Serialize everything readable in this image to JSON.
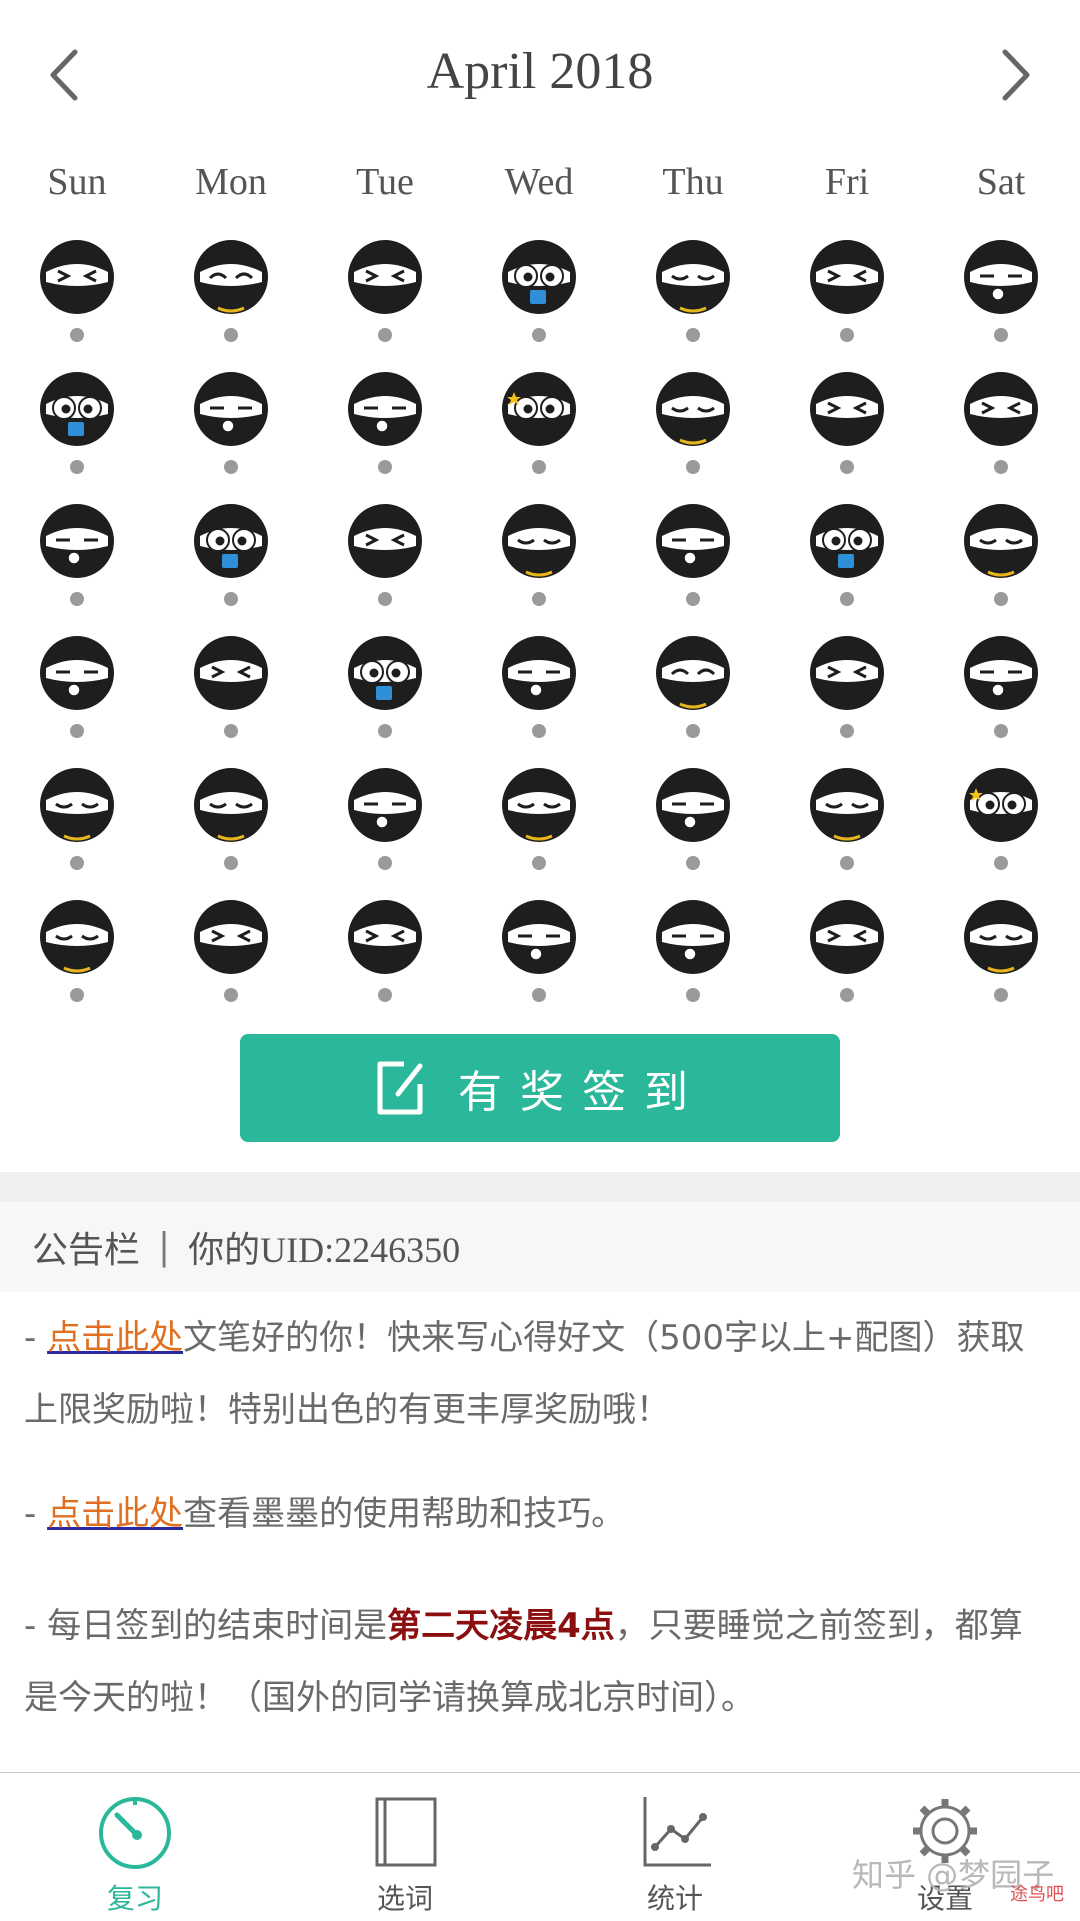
{
  "header": {
    "title": "April 2018",
    "prev_icon": "chevron-left-icon",
    "next_icon": "chevron-right-icon"
  },
  "weekdays": [
    "Sun",
    "Mon",
    "Tue",
    "Wed",
    "Thu",
    "Fri",
    "Sat"
  ],
  "calendar": {
    "rows": [
      [
        "squint",
        "wink",
        "squint",
        "book",
        "sleepy",
        "squint",
        "monocle"
      ],
      [
        "book",
        "monocle",
        "monocle",
        "star",
        "sleepy",
        "squint",
        "squint"
      ],
      [
        "monocle",
        "book",
        "squint",
        "sleepy",
        "monocle",
        "book",
        "sleepy"
      ],
      [
        "monocle",
        "squint",
        "book",
        "monocle",
        "wink",
        "squint",
        "monocle"
      ],
      [
        "sleepy",
        "sleepy",
        "monocle",
        "sleepy",
        "monocle",
        "sleepy",
        "star"
      ],
      [
        "sleepy",
        "squint",
        "squint",
        "monocle",
        "monocle",
        "squint",
        "sleepy"
      ]
    ],
    "dot_color": "#9a9a9a"
  },
  "checkin": {
    "label": "有奖签到",
    "icon": "edit-icon",
    "color": "#2bb89a"
  },
  "board": {
    "title": "公告栏",
    "separator": "|",
    "uid": "你的UID:2246350"
  },
  "notices": [
    {
      "prefix": "- ",
      "link": "点击此处",
      "text": "文笔好的你！快来写心得好文（500字以上+配图）获取上限奖励啦！特别出色的有更丰厚奖励哦！"
    },
    {
      "prefix": "- ",
      "link": "点击此处",
      "text": "查看墨墨的使用帮助和技巧。"
    },
    {
      "prefix": "- 每日签到的结束时间是",
      "highlight": "第二天凌晨4点",
      "text": "，只要睡觉之前签到，都算是今天的啦！（国外的同学请换算成北京时间）。"
    }
  ],
  "tabs": [
    {
      "label": "复习",
      "icon": "speedometer-icon",
      "active": true
    },
    {
      "label": "选词",
      "icon": "book-icon",
      "active": false
    },
    {
      "label": "统计",
      "icon": "line-chart-icon",
      "active": false
    },
    {
      "label": "设置",
      "icon": "gear-icon",
      "active": false
    }
  ],
  "watermark": {
    "text": "知乎 @梦园子",
    "site": "途鸟吧"
  }
}
